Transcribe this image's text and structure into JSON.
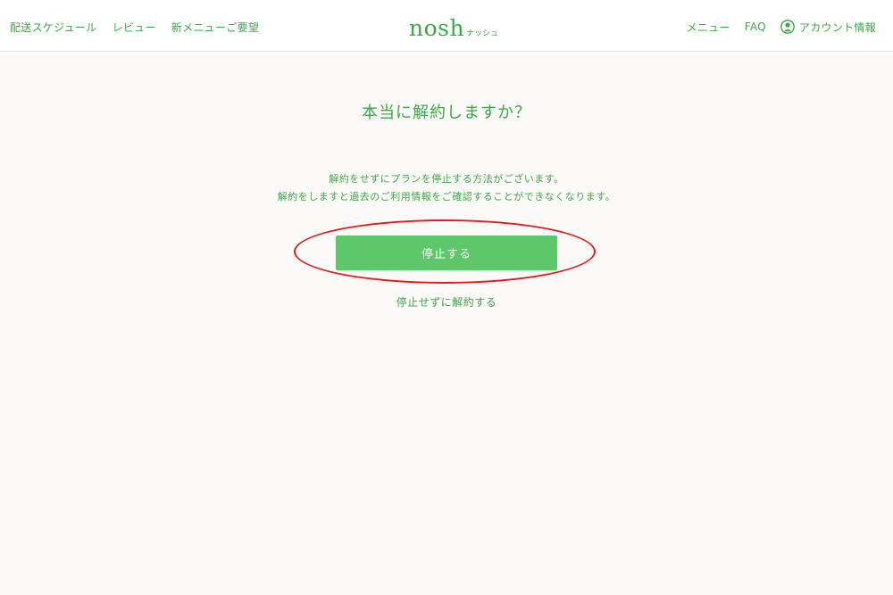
{
  "header": {
    "nav_left": [
      {
        "label": "配送スケジュール"
      },
      {
        "label": "レビュー"
      },
      {
        "label": "新メニューご要望"
      }
    ],
    "logo": {
      "main": "nosh",
      "sub": "ナッシュ"
    },
    "nav_right": {
      "menu": "メニュー",
      "faq": "FAQ",
      "account": "アカウント情報",
      "account_icon": "user-circle-icon"
    }
  },
  "main": {
    "title": "本当に解約しますか？",
    "description": [
      "解約をせずにプランを停止する方法がございます。",
      "解約をしますと過去のご利用情報をご確認することができなくなります。"
    ],
    "stop_button": "停止する",
    "cancel_link": "停止せずに解約する"
  },
  "colors": {
    "accent": "#3aa844",
    "button": "#5dc86a",
    "highlight": "#e3191a",
    "background": "#fbfaf8"
  }
}
